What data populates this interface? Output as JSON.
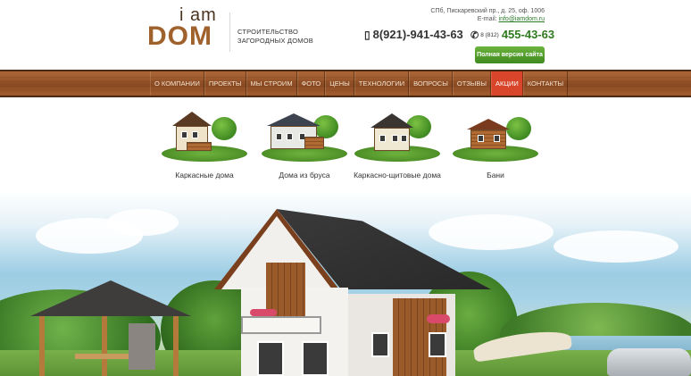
{
  "logo": {
    "line1": "i am",
    "line2": "DOM"
  },
  "tagline": [
    "СТРОИТЕЛЬСТВО",
    "ЗАГОРОДНЫХ ДОМОВ"
  ],
  "address": {
    "line": "СПб, Пискаревский пр., д. 25, оф. 1006",
    "email_label": "E-mail:",
    "email": "info@iamdom.ru"
  },
  "phones": {
    "mobile": "8(921)-941-43-63",
    "city_code": "8 (812)",
    "city_number": "455-43-63",
    "icon_mobile": "mobile-phone-icon",
    "icon_city": "handset-icon"
  },
  "full_version_button": "Полная версия сайта",
  "nav": {
    "items": [
      "О КОМПАНИИ",
      "ПРОЕКТЫ",
      "МЫ СТРОИМ",
      "ФОТО",
      "ЦЕНЫ",
      "ТЕХНОЛОГИИ",
      "ВОПРОСЫ",
      "ОТЗЫВЫ",
      "АКЦИИ",
      "КОНТАКТЫ"
    ],
    "active": "АКЦИИ"
  },
  "categories": [
    {
      "label": "Каркасные дома"
    },
    {
      "label": "Дома из бруса"
    },
    {
      "label": "Каркасно-щитовые дома"
    },
    {
      "label": "Бани"
    }
  ],
  "colors": {
    "brand_brown": "#a0622c",
    "nav_wood": "#8a4a22",
    "nav_active": "#d8452a",
    "button_green": "#4f9a2a",
    "email_green": "#2a7a2a"
  }
}
